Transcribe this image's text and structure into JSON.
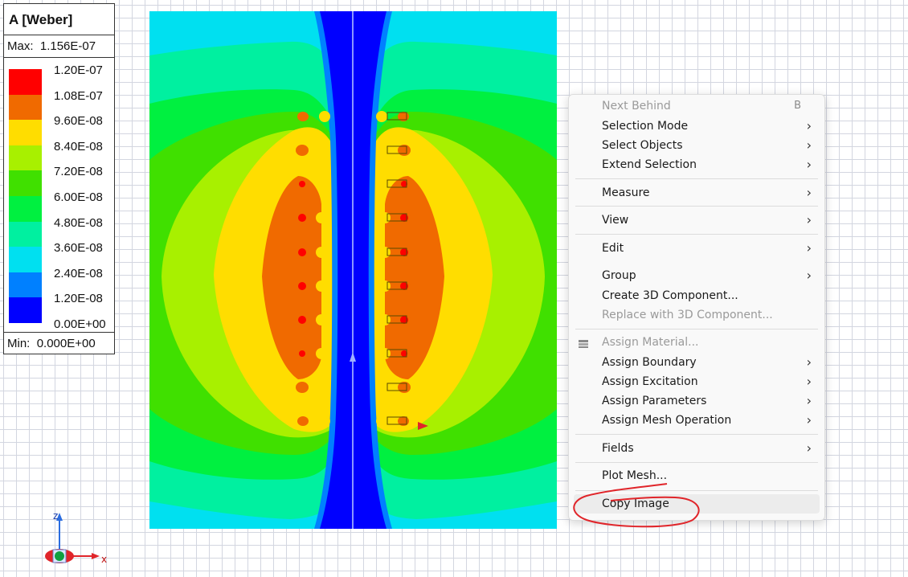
{
  "legend": {
    "title": "A [Weber]",
    "max_label": "Max:",
    "max_value": "1.156E-07",
    "min_label": "Min:",
    "min_value": "0.000E+00",
    "ticks": [
      "1.20E-07",
      "1.08E-07",
      "9.60E-08",
      "8.40E-08",
      "7.20E-08",
      "6.00E-08",
      "4.80E-08",
      "3.60E-08",
      "2.40E-08",
      "1.20E-08",
      "0.00E+00"
    ],
    "colors": [
      "#ff0000",
      "#f06a00",
      "#ffdd00",
      "#a8f000",
      "#40e000",
      "#00f040",
      "#00f0a0",
      "#00e0f0",
      "#0080ff",
      "#0000ff"
    ]
  },
  "menu": {
    "items": [
      {
        "label": "Next Behind",
        "shortcut": "B",
        "disabled": true
      },
      {
        "label": "Selection Mode",
        "submenu": true
      },
      {
        "label": "Select Objects",
        "submenu": true
      },
      {
        "label": "Extend Selection",
        "submenu": true
      },
      {
        "label": "Measure",
        "submenu": true
      },
      {
        "label": "View",
        "submenu": true
      },
      {
        "label": "Edit",
        "submenu": true
      },
      {
        "label": "Group",
        "submenu": true
      },
      {
        "label": "Create 3D Component..."
      },
      {
        "label": "Replace with 3D Component...",
        "disabled": true
      },
      {
        "label": "Assign Material...",
        "disabled": true,
        "icon": "material-stack-icon"
      },
      {
        "label": "Assign Boundary",
        "submenu": true
      },
      {
        "label": "Assign Excitation",
        "submenu": true
      },
      {
        "label": "Assign Parameters",
        "submenu": true
      },
      {
        "label": "Assign Mesh Operation",
        "submenu": true
      },
      {
        "label": "Fields",
        "submenu": true
      },
      {
        "label": "Plot Mesh..."
      },
      {
        "label": "Copy Image",
        "highlighted": true
      }
    ]
  },
  "triad": {
    "z_label": "z",
    "x_label": "x"
  },
  "colors": {
    "annotation_red": "#e0252a",
    "background_blue": "#0000ff"
  }
}
